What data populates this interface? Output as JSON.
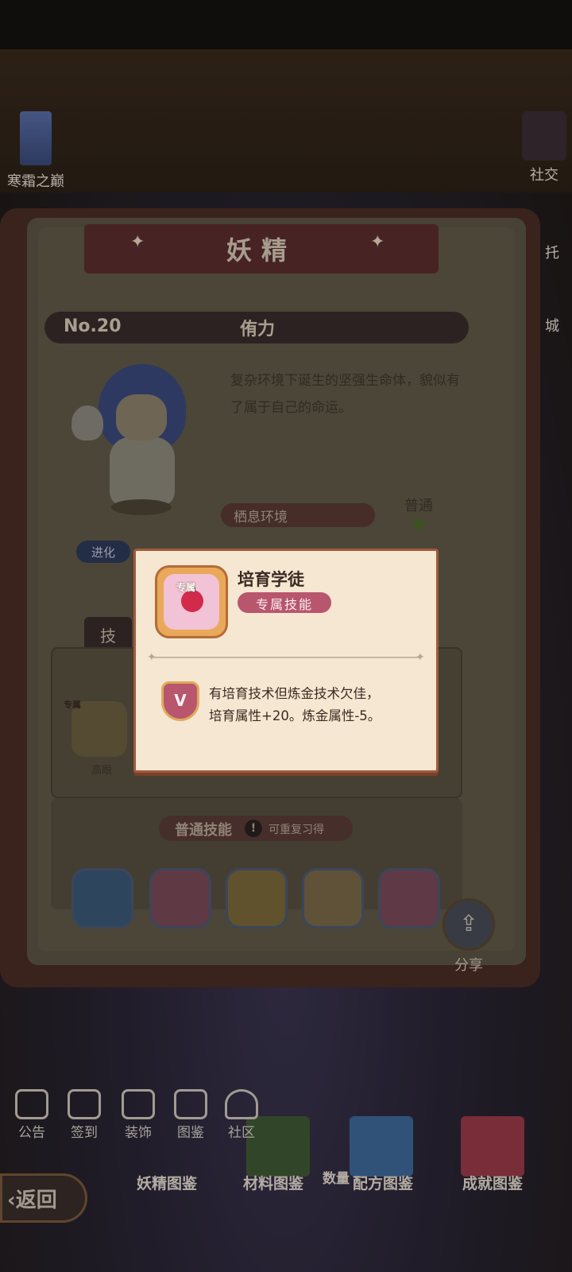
{
  "side_left": {
    "label": "寒霜之巅"
  },
  "side_right": [
    {
      "label": "社交"
    },
    {
      "label": "托"
    },
    {
      "label": "城"
    }
  ],
  "book": {
    "title": "妖精",
    "number": "No.20",
    "name": "侑力",
    "description": "复杂环境下诞生的坚强生命体，貌似有了属于自己的命运。",
    "habitat_label": "栖息环境",
    "rarity_label": "普通",
    "evolve_label": "进化",
    "skill_tab_label": "技",
    "exclusive_tag": "专属",
    "skill_caps": [
      "高眼",
      "培育学徒"
    ],
    "normal_skills_title": "普通技能",
    "normal_skills_note": "可重复习得"
  },
  "share": {
    "label": "分享"
  },
  "bottom_nav": [
    {
      "label": "公告",
      "icon": "notice-icon"
    },
    {
      "label": "签到",
      "icon": "calendar-icon"
    },
    {
      "label": "装饰",
      "icon": "decor-icon"
    },
    {
      "label": "图鉴",
      "icon": "book-icon"
    },
    {
      "label": "社区",
      "icon": "home-icon"
    }
  ],
  "categories": [
    "妖精图鉴",
    "材料图鉴",
    "配方图鉴",
    "成就图鉴"
  ],
  "quantity_label": "数量",
  "back_label": "返回",
  "popup": {
    "exclusive_tag": "专属",
    "skill_name": "培育学徒",
    "skill_type": "专属技能",
    "effect_line1": "有培育技术但炼金技术欠佳，",
    "effect_line2": "培育属性+20。炼金属性-5。",
    "shield_letter": "V"
  }
}
